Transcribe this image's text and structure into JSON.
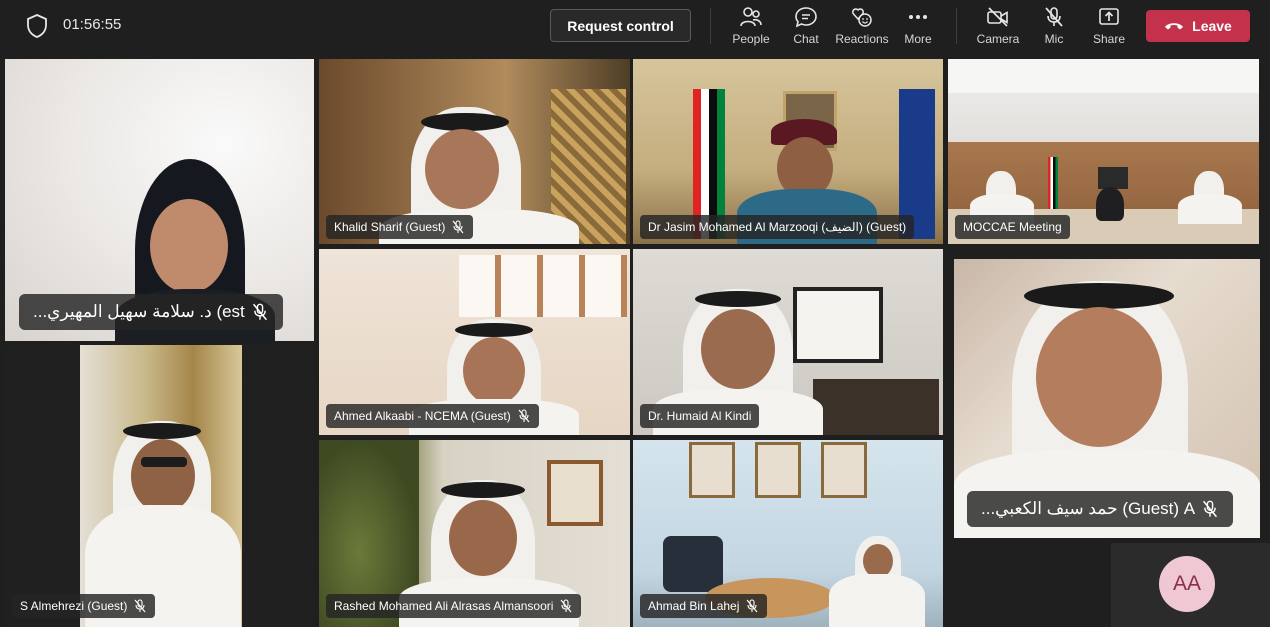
{
  "meeting": {
    "timer": "01:56:55",
    "request_control_label": "Request control",
    "toolbar": [
      {
        "label": "People",
        "icon": "people-icon"
      },
      {
        "label": "Chat",
        "icon": "chat-icon"
      },
      {
        "label": "Reactions",
        "icon": "reactions-icon"
      },
      {
        "label": "More",
        "icon": "more-icon"
      },
      {
        "label": "Camera",
        "icon": "camera-off-icon"
      },
      {
        "label": "Mic",
        "icon": "mic-off-icon"
      },
      {
        "label": "Share",
        "icon": "share-icon"
      }
    ],
    "leave_label": "Leave",
    "leave_color": "#c4314b",
    "active_speaker_outline": "#a6a7dc"
  },
  "participants": [
    {
      "name": "د. سلامة سهيل المهيري (Guest)...",
      "display": "...د. سلامة سهيل المهيري (est",
      "muted": true
    },
    {
      "name": "Khalid Sharif (Guest)",
      "display": "Khalid Sharif (Guest)",
      "muted": true
    },
    {
      "name": "Dr Jasim Mohamed Al Marzooqi (الضيف) (Guest)",
      "display": "Dr Jasim Mohamed Al Marzooqi (الضيف) (Guest)",
      "muted": false
    },
    {
      "name": "MOCCAE Meeting",
      "display": "MOCCAE Meeting",
      "muted": false
    },
    {
      "name": "Ahmed Alkaabi - NCEMA (Guest)",
      "display": "Ahmed Alkaabi - NCEMA (Guest)",
      "muted": true
    },
    {
      "name": "Dr. Humaid Al Kindi",
      "display": "Dr. Humaid Al Kindi",
      "muted": false
    },
    {
      "name": "حمد سيف الكعبي A... (Guest)",
      "display": "...حمد سيف الكعبي (Guest) A",
      "muted": true
    },
    {
      "name": "S Almehrezi (Guest)",
      "display": "S Almehrezi (Guest)",
      "muted": true
    },
    {
      "name": "Rashed Mohamed Ali Alrasas Almansoori",
      "display": "Rashed Mohamed Ali Alrasas Almansoori",
      "muted": true
    },
    {
      "name": "Ahmad Bin Lahej",
      "display": "Ahmad Bin Lahej",
      "muted": true
    }
  ],
  "overflow_avatar": {
    "initials": "AA",
    "bg": "#f0c8d4",
    "fg": "#8a2e4e"
  }
}
